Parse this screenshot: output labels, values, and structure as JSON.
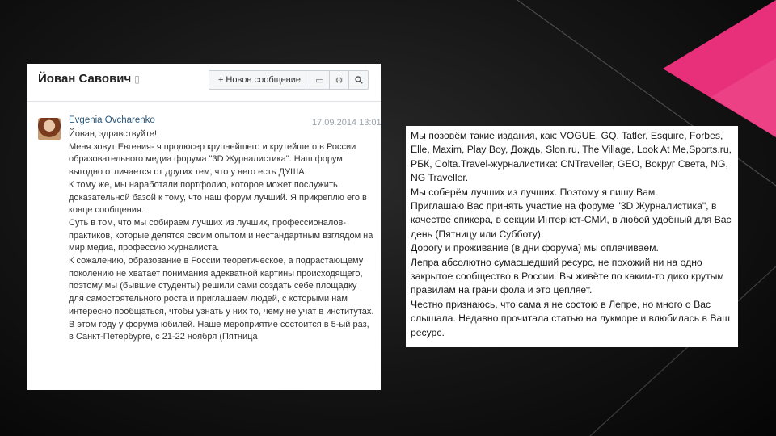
{
  "colors": {
    "background": "#141414",
    "accent_pink": "#e8307a",
    "link_blue": "#2b587a"
  },
  "dialog": {
    "title": "Йован Савович",
    "toolbar": {
      "new_message_icon": "plus-icon",
      "new_message_label": "Новое сообщение",
      "media_icon": "media-icon",
      "settings_icon": "gear-icon",
      "search_icon": "search-icon"
    },
    "message": {
      "author": "Evgenia Ovcharenko",
      "date": "17.09.2014 13:01",
      "lines": [
        "Йован, здравствуйте!",
        "Меня зовут Евгения- я продюсер крупнейшего и крутейшего в России образовательного медиа форума \"3D Журналистика\". Наш форум выгодно отличается от других тем, что у него есть ДУША.",
        "К тому же, мы наработали портфолио, которое может послужить доказательной базой к тому, что наш форум лучший. Я прикреплю его в конце сообщения.",
        "Суть в том, что мы собираем лучших из лучших, профессионалов-практиков, которые делятся своим опытом и нестандартным взглядом на мир медиа, профессию журналиста.",
        "К сожалению, образование в России теоретическое, а подрастающему поколению не хватает понимания адекватной картины происходящего, поэтому мы (бывшие студенты) решили сами создать себе площадку для самостоятельного роста и приглашаем людей, с которыми нам интересно пообщаться, чтобы узнать у них то, чему не учат в институтах.",
        "В этом году у форума юбилей. Наше мероприятие состоится в 5-ый раз, в Санкт-Петербурге, с 21-22 ноября (Пятница"
      ]
    }
  },
  "quote": {
    "lines": [
      "Мы позовём такие издания, как: VOGUE, GQ, Tatler, Esquire, Forbes, Elle, Maxim, Play Boy, Дождь, Slon.ru, The Village, Look At Me,Sports.ru, РБК, Colta.Travel-журналистика: CNTraveller, GEO, Вокруг Света, NG, NG Traveller.",
      "Мы соберём лучших из лучших. Поэтому я пишу Вам.",
      "Приглашаю Вас принять участие на форуме \"3D Журналистика\", в качестве спикера, в секции Интернет-СМИ, в любой удобный для Вас день (Пятницу или Субботу).",
      "Дорогу и проживание (в дни форума) мы оплачиваем.",
      "Лепра абсолютно сумасшедший ресурс, не похожий ни на одно закрытое сообщество в России. Вы живёте по каким-то дико крутым правилам на грани фола и это цепляет.",
      "Честно признаюсь, что сама я не состою в Лепре, но много о Вас слышала. Недавно прочитала статью на лукморе и влюбилась в Ваш ресурс."
    ]
  }
}
